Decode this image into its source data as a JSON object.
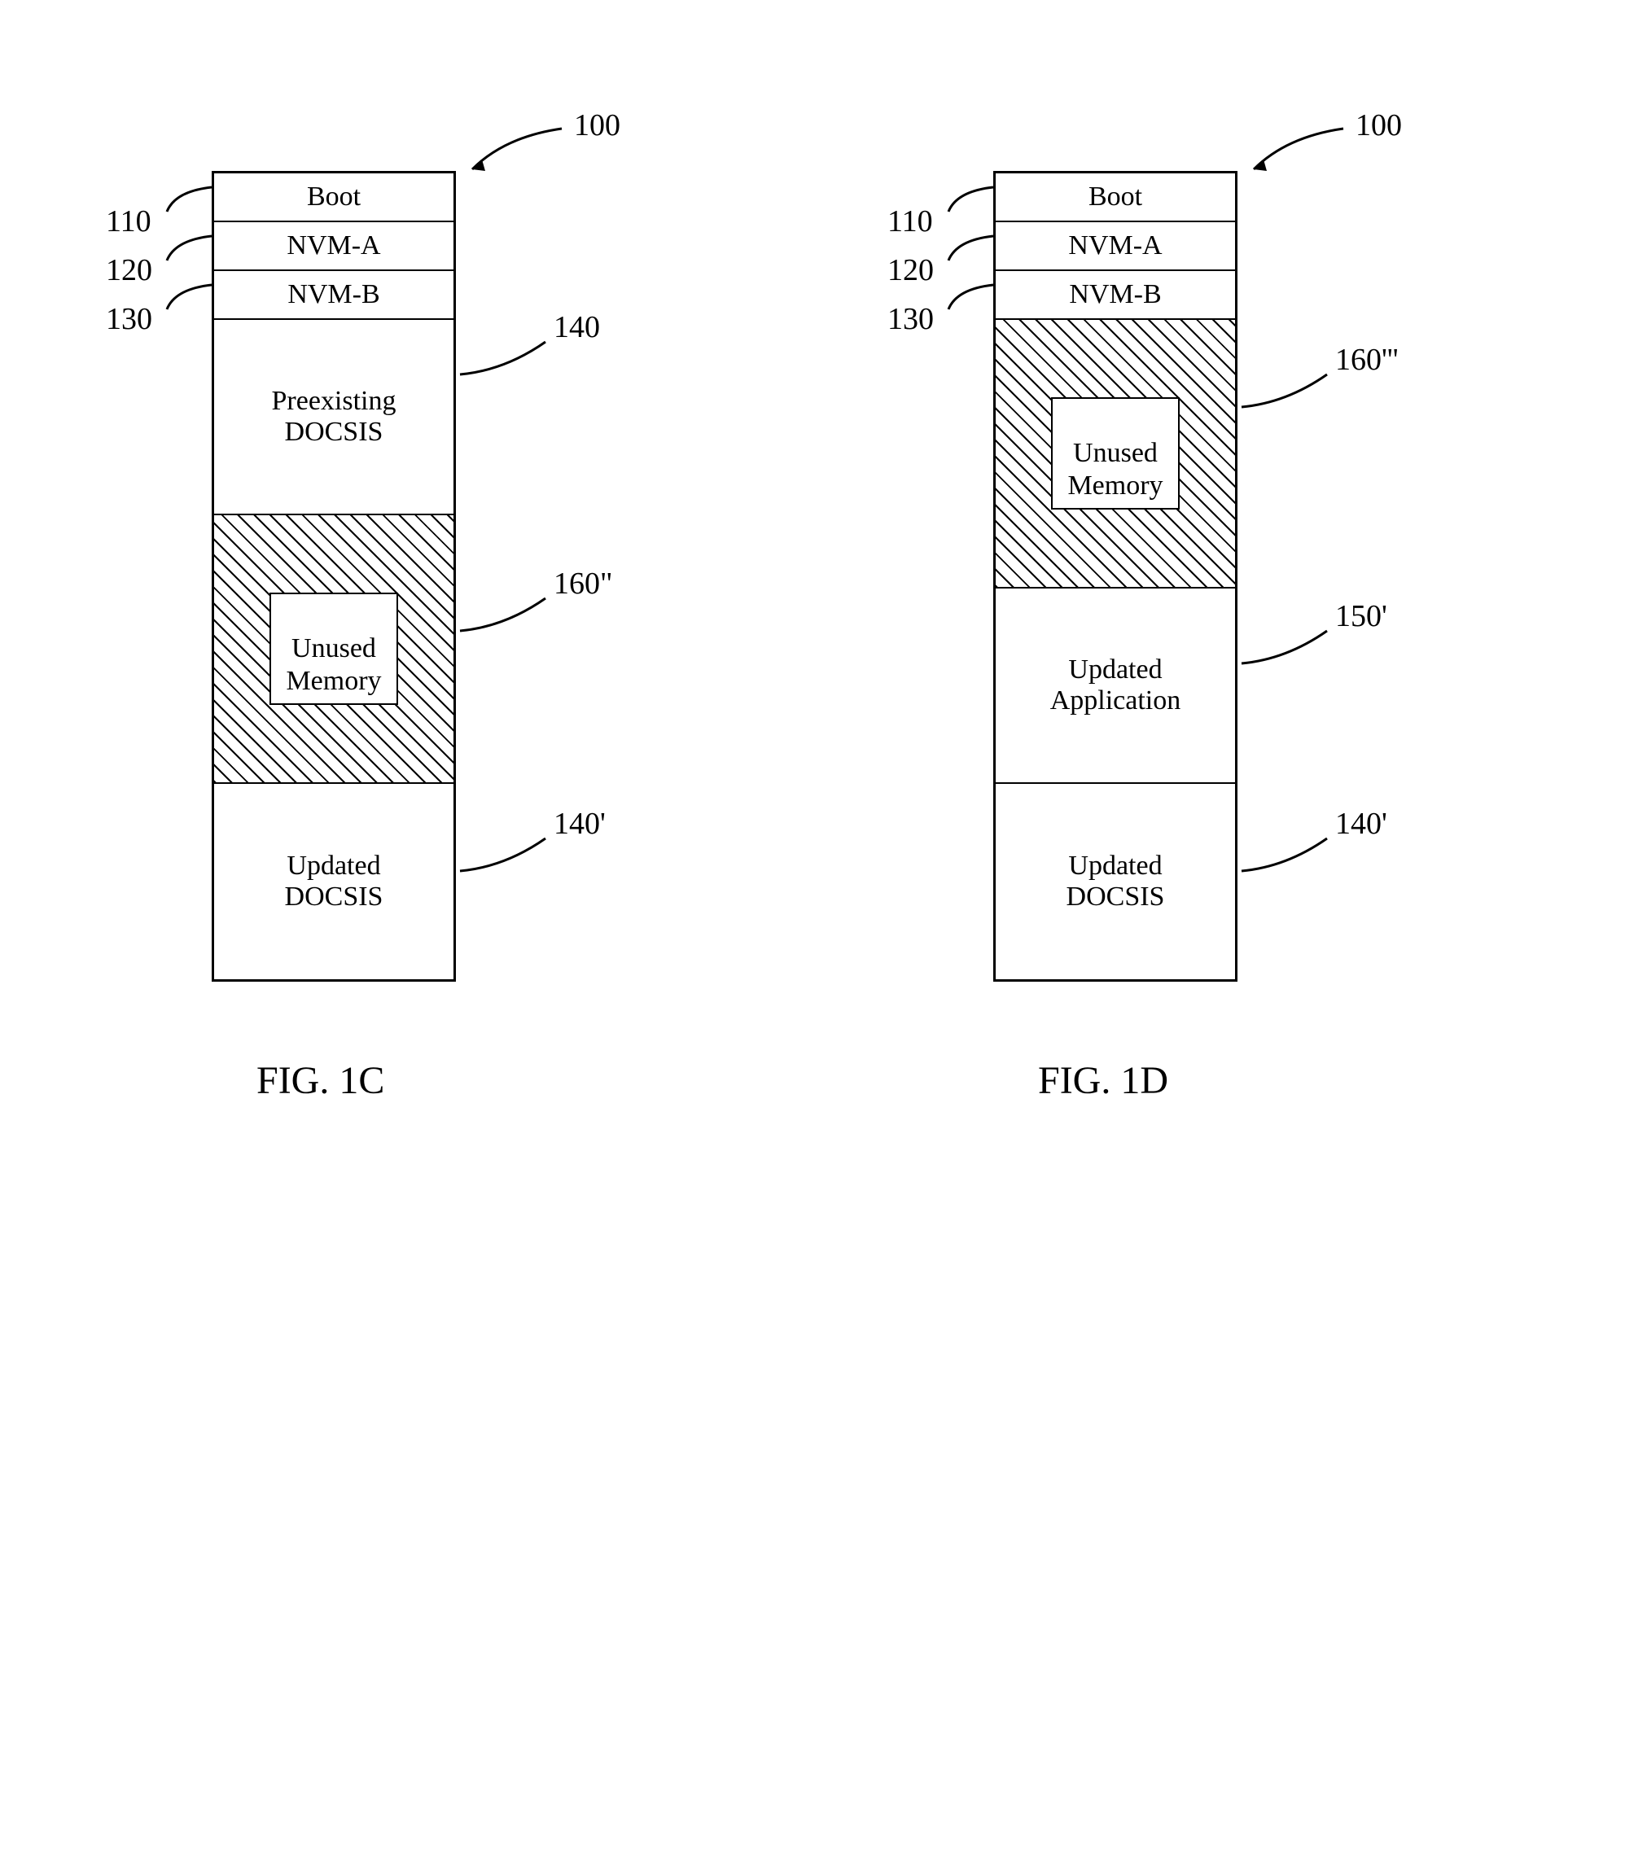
{
  "figureC": {
    "topRef": "100",
    "leftRefs": [
      "110",
      "120",
      "130"
    ],
    "blocks": {
      "boot": "Boot",
      "nvmA": "NVM-A",
      "nvmB": "NVM-B",
      "preexistingDocsis": "Preexisting\nDOCSIS",
      "unusedMemory": "Unused\nMemory",
      "updatedDocsis": "Updated\nDOCSIS"
    },
    "rightRefs": {
      "preexistingDocsis": "140",
      "unusedMemory": "160\"",
      "updatedDocsis": "140'"
    },
    "caption": "FIG. 1C"
  },
  "figureD": {
    "topRef": "100",
    "leftRefs": [
      "110",
      "120",
      "130"
    ],
    "blocks": {
      "boot": "Boot",
      "nvmA": "NVM-A",
      "nvmB": "NVM-B",
      "unusedMemory": "Unused\nMemory",
      "updatedApplication": "Updated\nApplication",
      "updatedDocsis": "Updated\nDOCSIS"
    },
    "rightRefs": {
      "unusedMemory": "160'''",
      "updatedApplication": "150'",
      "updatedDocsis": "140'"
    },
    "caption": "FIG. 1D"
  }
}
